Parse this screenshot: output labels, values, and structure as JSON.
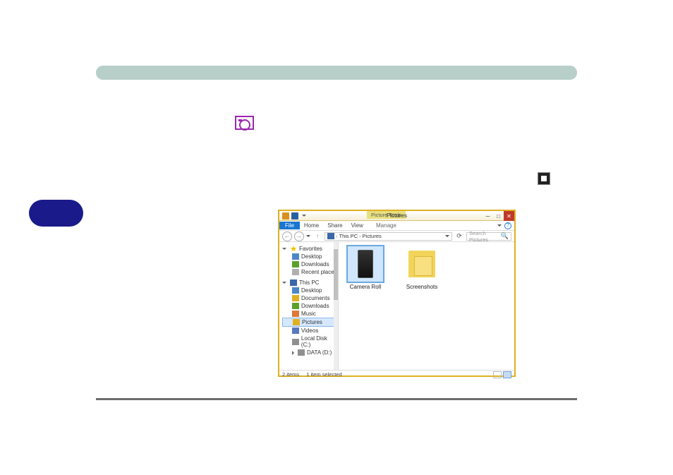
{
  "explorer": {
    "contextual_tab": "Picture Tools",
    "window_title": "Pictures",
    "ribbon": {
      "file": "File",
      "home": "Home",
      "share": "Share",
      "view": "View",
      "manage": "Manage"
    },
    "address": {
      "pc": "This PC",
      "folder": "Pictures",
      "search_placeholder": "Search Pictures"
    },
    "sidebar": {
      "favorites": {
        "label": "Favorites",
        "items": [
          "Desktop",
          "Downloads",
          "Recent places"
        ]
      },
      "thispc": {
        "label": "This PC",
        "items": [
          "Desktop",
          "Documents",
          "Downloads",
          "Music",
          "Pictures",
          "Videos",
          "Local Disk (C:)",
          "DATA (D:)"
        ]
      }
    },
    "items": [
      {
        "label": "Camera Roll",
        "selected": true
      },
      {
        "label": "Screenshots",
        "selected": false
      }
    ],
    "status": {
      "count": "2 items",
      "selection": "1 item selected"
    }
  }
}
